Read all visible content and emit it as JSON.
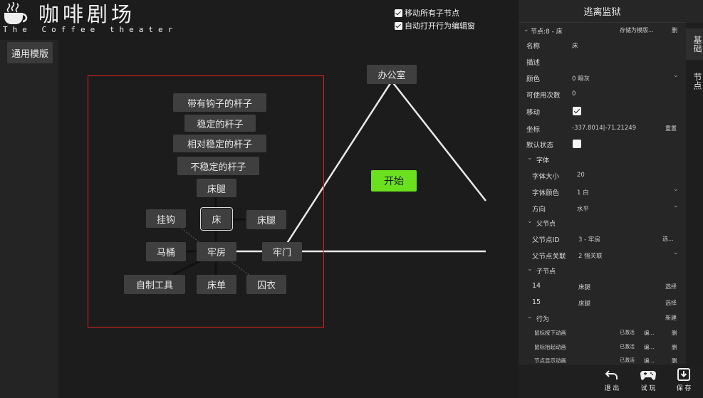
{
  "app": {
    "title": "咖啡剧场",
    "subtitle": "The Coffee theater"
  },
  "sidebar": {
    "template_button": "通用模版"
  },
  "canvas": {
    "options": [
      {
        "label": "移动所有子节点",
        "checked": true
      },
      {
        "label": "自动打开行为编辑窗",
        "checked": true
      }
    ],
    "nodes": {
      "hook_pole": "带有钩子的杆子",
      "stable_pole": "稳定的杆子",
      "rel_stable_pole": "相对稳定的杆子",
      "unstable_pole": "不稳定的杆子",
      "bed_leg_top": "床腿",
      "hook": "挂钩",
      "bed": "床",
      "bed_leg_right": "床腿",
      "toilet": "马桶",
      "cell": "牢房",
      "cell_door": "牢门",
      "homemade_tool": "自制工具",
      "bedsheet": "床单",
      "prison_clothes": "囚衣",
      "office": "办公室",
      "start": "开始"
    }
  },
  "panel": {
    "title": "逃离监狱",
    "node_header": "节点:8 - 床",
    "save_as_template": "存储为模版...",
    "delete": "删",
    "side_tabs": [
      "基础",
      "节点"
    ],
    "fields": {
      "name_label": "名称",
      "name_value": "床",
      "desc_label": "描述",
      "color_label": "颜色",
      "color_value": "0 暗灰",
      "uses_label": "可使用次数",
      "uses_value": "0",
      "move_label": "移动",
      "move_checked": true,
      "coord_label": "坐标",
      "coord_value": "-337.8014|-71.21249",
      "reset": "重置",
      "default_state_label": "默认状态",
      "default_state_checked": false
    },
    "font": {
      "header": "字体",
      "size_label": "字体大小",
      "size_value": "20",
      "color_label": "字体颜色",
      "color_value": "1 白",
      "dir_label": "方向",
      "dir_value": "水平"
    },
    "parent": {
      "header": "父节点",
      "id_label": "父节点ID",
      "id_value": "3 - 牢房",
      "select": "选...",
      "rel_label": "父节点关联",
      "rel_value": "2 强关联"
    },
    "children": {
      "header": "子节点",
      "items": [
        {
          "id": "14",
          "name": "床腿",
          "action": "选择"
        },
        {
          "id": "15",
          "name": "床腿",
          "action": "选择"
        }
      ]
    },
    "behavior": {
      "header": "行为",
      "new": "新建",
      "items": [
        {
          "name": "鼠标按下动画",
          "status": "已激活",
          "edit": "编...",
          "del": "删"
        },
        {
          "name": "鼠标抬起动画",
          "status": "已激活",
          "edit": "编...",
          "del": "删"
        },
        {
          "name": "节点显示动画",
          "status": "已激活",
          "edit": "编...",
          "del": "删"
        }
      ]
    }
  },
  "toolbar": {
    "exit": "退 出",
    "test": "试 玩",
    "save": "保 存"
  },
  "colors": {
    "start_node": "#6be01f",
    "selection": "#e02020",
    "node_bg": "#3f3f3f"
  }
}
